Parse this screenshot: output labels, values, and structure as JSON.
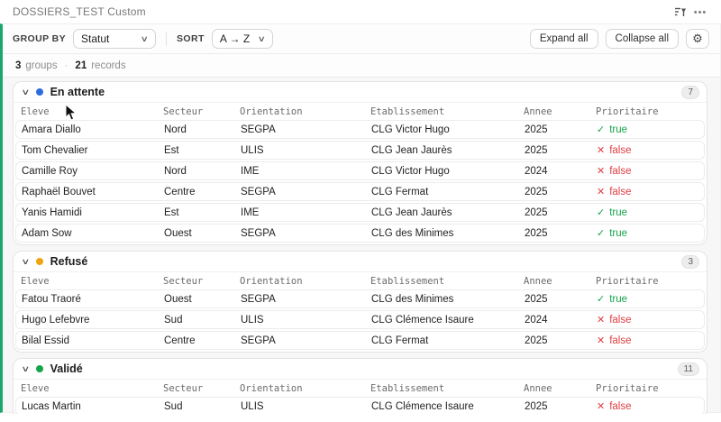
{
  "window": {
    "title": "DOSSIERS_TEST Custom",
    "more_icon": "•••"
  },
  "toolbar": {
    "group_by_label": "GROUP BY",
    "group_by_value": "Statut",
    "sort_label": "SORT",
    "sort_value": "A → Z",
    "expand_all_label": "Expand all",
    "collapse_all_label": "Collapse all",
    "gear_icon": "⚙"
  },
  "summary": {
    "groups_count": "3",
    "groups_label": "groups",
    "separator": "·",
    "records_count": "21",
    "records_label": "records"
  },
  "columns": [
    "Eleve",
    "Secteur",
    "Orientation",
    "Etablissement",
    "Annee",
    "Prioritaire"
  ],
  "icons": {
    "chevron_down": "∨"
  },
  "colors": {
    "accent_green": "#18A86B",
    "group_en_attente_dot": "#2D6CDF",
    "group_refuse_dot": "#EFA40F",
    "group_valide_dot": "#16A34A"
  },
  "prioritaire": {
    "check": "✓",
    "cross": "✕",
    "true_label": "true",
    "false_label": "false",
    "true_color": "#16A34A",
    "false_color": "#DF3E42"
  },
  "groups": [
    {
      "name": "En attente",
      "count": "7",
      "dot_color": "#2D6CDF",
      "rows": [
        [
          "Amara Diallo",
          "Nord",
          "SEGPA",
          "CLG Victor Hugo",
          "2025",
          true
        ],
        [
          "Tom Chevalier",
          "Est",
          "ULIS",
          "CLG Jean Jaurès",
          "2025",
          false
        ],
        [
          "Camille Roy",
          "Nord",
          "IME",
          "CLG Victor Hugo",
          "2024",
          false
        ],
        [
          "Raphaël Bouvet",
          "Centre",
          "SEGPA",
          "CLG Fermat",
          "2025",
          false
        ],
        [
          "Yanis Hamidi",
          "Est",
          "IME",
          "CLG Jean Jaurès",
          "2025",
          true
        ],
        [
          "Adam Sow",
          "Ouest",
          "SEGPA",
          "CLG des Minimes",
          "2025",
          true
        ]
      ]
    },
    {
      "name": "Refusé",
      "count": "3",
      "dot_color": "#EFA40F",
      "rows": [
        [
          "Fatou Traoré",
          "Ouest",
          "SEGPA",
          "CLG des Minimes",
          "2025",
          true
        ],
        [
          "Hugo Lefebvre",
          "Sud",
          "ULIS",
          "CLG Clémence Isaure",
          "2024",
          false
        ],
        [
          "Bilal Essid",
          "Centre",
          "SEGPA",
          "CLG Fermat",
          "2025",
          false
        ]
      ]
    },
    {
      "name": "Validé",
      "count": "11",
      "dot_color": "#16A34A",
      "rows": [
        [
          "Lucas Martin",
          "Sud",
          "ULIS",
          "CLG Clémence Isaure",
          "2025",
          false
        ]
      ]
    }
  ]
}
